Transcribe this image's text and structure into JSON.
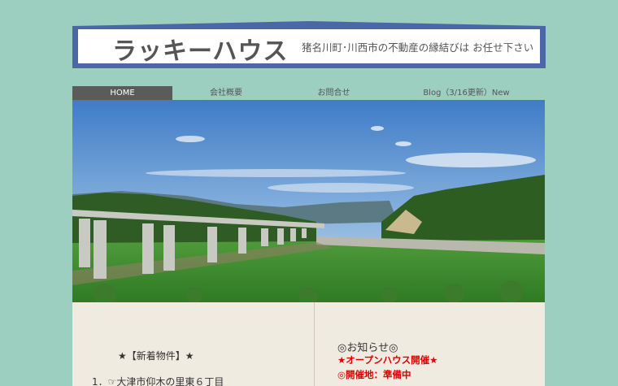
{
  "header": {
    "site_title": "ラッキーハウス",
    "tagline": "猪名川町･川西市の不動産の縁結びは お任せ下さい"
  },
  "nav": {
    "items": [
      {
        "label": "HOME",
        "active": true
      },
      {
        "label": "会社概要",
        "active": false
      },
      {
        "label": "お問合せ",
        "active": false
      },
      {
        "label": "Blog（3/16更新）New",
        "active": false
      }
    ]
  },
  "new_listings": {
    "heading": "★【新着物件】★",
    "items": [
      "1．☞大津市仰木の里東６丁目"
    ]
  },
  "notices": {
    "title": "◎お知らせ◎",
    "line1": "★オープンハウス開催★",
    "line2": "◎開催地：準備中"
  },
  "colors": {
    "page_bg": "#9ccfbf",
    "header_frame": "#4b67a8",
    "nav_active": "#5b5b5b",
    "content_bg": "#f0ebe1",
    "notice_red": "#e00000"
  }
}
